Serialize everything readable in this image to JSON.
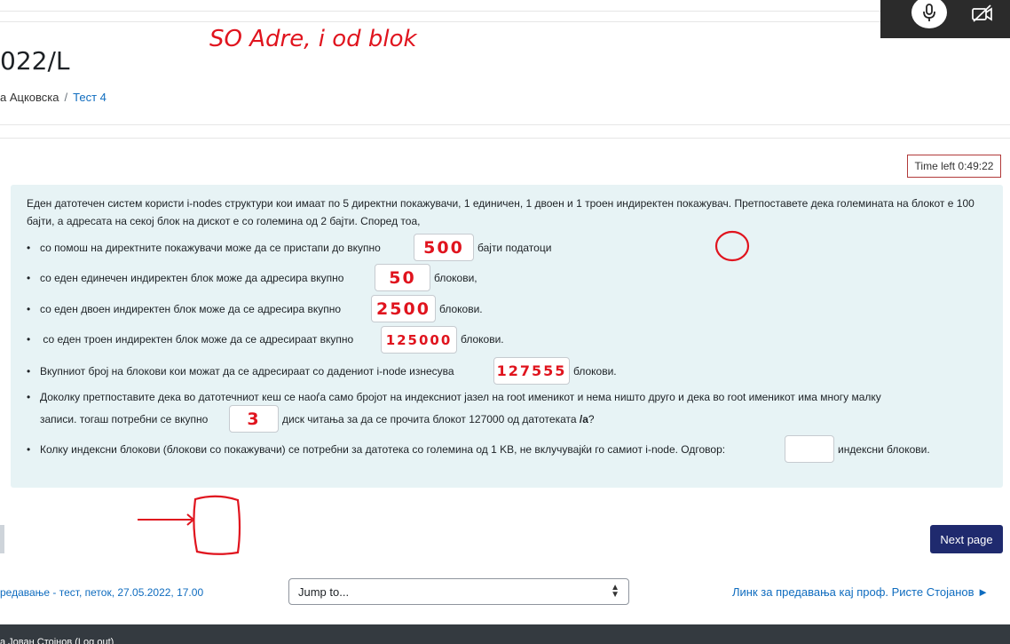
{
  "header": {
    "title": "022/L",
    "breadcrumbs": [
      "а Ацковска",
      "Тест 4"
    ],
    "separator": "/"
  },
  "media": {
    "mic_icon": "microphone-icon",
    "camera_icon": "camera-off-icon"
  },
  "timer": {
    "label": "Time left 0:49:22"
  },
  "question": {
    "intro": "Еден датотечен систем користи i-nodes структури кои имаат по 5 директни покажувачи, 1 единичен, 1 двоен и 1 троен индиректен покажувач. Претпоставете дека големината на блокот е 100 бајти, а адресата на секој блок на дискот е со големина од 2 бајти. Според тоа,",
    "bullet": "•",
    "items": [
      {
        "before": "со помош на директните покажувачи може да се пристапи до вкупно",
        "answer": "500",
        "after": "бајти податоци"
      },
      {
        "before": "со еден единечен индиректен блок може да адресира вкупно",
        "answer": "50",
        "after": "блокови,"
      },
      {
        "before": "со еден двоен индиректен блок може да се адресира  вкупно",
        "answer": "2500",
        "after": "блокови."
      },
      {
        "before": " со еден троен индиректен блок може да се адресираат вкупно",
        "answer": "125000",
        "after": "блокови."
      },
      {
        "before": "Вкупниот број на блокови кои можат да се адресираат со дадениот i-node изнесува",
        "answer": "127555",
        "after": "блокови."
      },
      {
        "before_line1": "Доколку претпоставите дека во датотечниот кеш се наоѓа само бројот на индексниот јазел на root именикот и нема ништо друго и дека во root именикот има многу малку",
        "before_line2": "записи. тогаш потребни се вкупно",
        "answer": "3",
        "after": "диск читања за да се прочита блокот 127000 од датотеката",
        "after_bold": "/a",
        "after_end": "?"
      },
      {
        "before": "Колку индексни блокови (блокови со покажувачи) се потребни за датотека со големина од 1 KB, не вклучувајќи го самиот i-node. Одговор:",
        "answer": "",
        "after": "индексни блокови."
      }
    ]
  },
  "handwriting": {
    "top_note": "SO Adre, i od blok"
  },
  "navigation": {
    "next_button": "Next page"
  },
  "footer_nav": {
    "prev_link": "редавање - тест, петок, 27.05.2022, 17.00",
    "jump_label": "Jump to...",
    "next_link": "Линк за предавања кај проф. Ристе Стојанов ►"
  },
  "footer": {
    "text": "а Јован Стојнов (Log out)"
  }
}
